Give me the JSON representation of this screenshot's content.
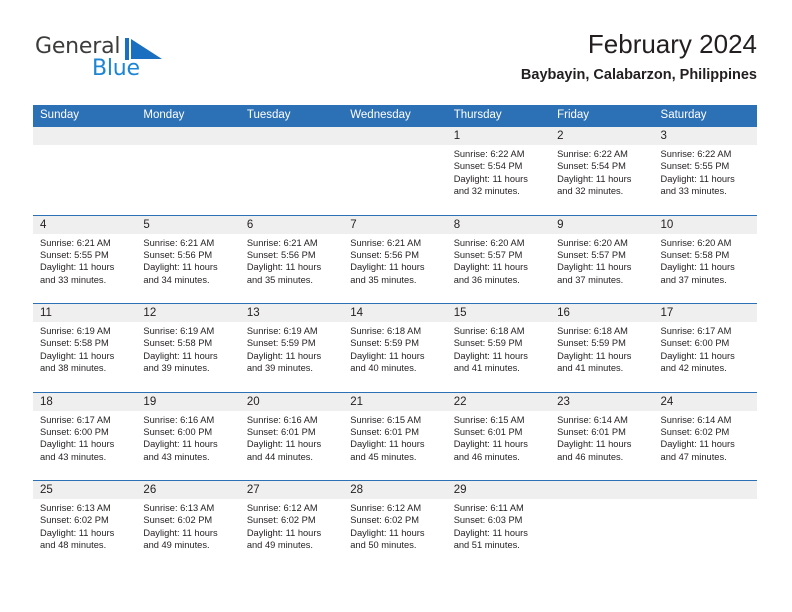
{
  "brand": {
    "name_part1": "General",
    "name_part2": "Blue",
    "sail_icon": "sail-triangle-icon",
    "colors": {
      "general": "#3c3c3b",
      "blue": "#1c86d4"
    }
  },
  "header": {
    "title": "February 2024",
    "subtitle": "Baybayin, Calabarzon, Philippines"
  },
  "theme": {
    "header_blue": "#2c70b5",
    "row_border_blue": "#2c70b5",
    "daynum_band": "#efefef",
    "text": "#231f20"
  },
  "weekdays": [
    "Sunday",
    "Monday",
    "Tuesday",
    "Wednesday",
    "Thursday",
    "Friday",
    "Saturday"
  ],
  "labels": {
    "sunrise": "Sunrise:",
    "sunset": "Sunset:",
    "daylight": "Daylight:"
  },
  "weeks": [
    [
      {
        "day": "",
        "empty": true
      },
      {
        "day": "",
        "empty": true
      },
      {
        "day": "",
        "empty": true
      },
      {
        "day": "",
        "empty": true
      },
      {
        "day": "1",
        "sunrise": "Sunrise: 6:22 AM",
        "sunset": "Sunset: 5:54 PM",
        "daylight_line1": "Daylight: 11 hours",
        "daylight_line2": "and 32 minutes."
      },
      {
        "day": "2",
        "sunrise": "Sunrise: 6:22 AM",
        "sunset": "Sunset: 5:54 PM",
        "daylight_line1": "Daylight: 11 hours",
        "daylight_line2": "and 32 minutes."
      },
      {
        "day": "3",
        "sunrise": "Sunrise: 6:22 AM",
        "sunset": "Sunset: 5:55 PM",
        "daylight_line1": "Daylight: 11 hours",
        "daylight_line2": "and 33 minutes."
      }
    ],
    [
      {
        "day": "4",
        "sunrise": "Sunrise: 6:21 AM",
        "sunset": "Sunset: 5:55 PM",
        "daylight_line1": "Daylight: 11 hours",
        "daylight_line2": "and 33 minutes."
      },
      {
        "day": "5",
        "sunrise": "Sunrise: 6:21 AM",
        "sunset": "Sunset: 5:56 PM",
        "daylight_line1": "Daylight: 11 hours",
        "daylight_line2": "and 34 minutes."
      },
      {
        "day": "6",
        "sunrise": "Sunrise: 6:21 AM",
        "sunset": "Sunset: 5:56 PM",
        "daylight_line1": "Daylight: 11 hours",
        "daylight_line2": "and 35 minutes."
      },
      {
        "day": "7",
        "sunrise": "Sunrise: 6:21 AM",
        "sunset": "Sunset: 5:56 PM",
        "daylight_line1": "Daylight: 11 hours",
        "daylight_line2": "and 35 minutes."
      },
      {
        "day": "8",
        "sunrise": "Sunrise: 6:20 AM",
        "sunset": "Sunset: 5:57 PM",
        "daylight_line1": "Daylight: 11 hours",
        "daylight_line2": "and 36 minutes."
      },
      {
        "day": "9",
        "sunrise": "Sunrise: 6:20 AM",
        "sunset": "Sunset: 5:57 PM",
        "daylight_line1": "Daylight: 11 hours",
        "daylight_line2": "and 37 minutes."
      },
      {
        "day": "10",
        "sunrise": "Sunrise: 6:20 AM",
        "sunset": "Sunset: 5:58 PM",
        "daylight_line1": "Daylight: 11 hours",
        "daylight_line2": "and 37 minutes."
      }
    ],
    [
      {
        "day": "11",
        "sunrise": "Sunrise: 6:19 AM",
        "sunset": "Sunset: 5:58 PM",
        "daylight_line1": "Daylight: 11 hours",
        "daylight_line2": "and 38 minutes."
      },
      {
        "day": "12",
        "sunrise": "Sunrise: 6:19 AM",
        "sunset": "Sunset: 5:58 PM",
        "daylight_line1": "Daylight: 11 hours",
        "daylight_line2": "and 39 minutes."
      },
      {
        "day": "13",
        "sunrise": "Sunrise: 6:19 AM",
        "sunset": "Sunset: 5:59 PM",
        "daylight_line1": "Daylight: 11 hours",
        "daylight_line2": "and 39 minutes."
      },
      {
        "day": "14",
        "sunrise": "Sunrise: 6:18 AM",
        "sunset": "Sunset: 5:59 PM",
        "daylight_line1": "Daylight: 11 hours",
        "daylight_line2": "and 40 minutes."
      },
      {
        "day": "15",
        "sunrise": "Sunrise: 6:18 AM",
        "sunset": "Sunset: 5:59 PM",
        "daylight_line1": "Daylight: 11 hours",
        "daylight_line2": "and 41 minutes."
      },
      {
        "day": "16",
        "sunrise": "Sunrise: 6:18 AM",
        "sunset": "Sunset: 5:59 PM",
        "daylight_line1": "Daylight: 11 hours",
        "daylight_line2": "and 41 minutes."
      },
      {
        "day": "17",
        "sunrise": "Sunrise: 6:17 AM",
        "sunset": "Sunset: 6:00 PM",
        "daylight_line1": "Daylight: 11 hours",
        "daylight_line2": "and 42 minutes."
      }
    ],
    [
      {
        "day": "18",
        "sunrise": "Sunrise: 6:17 AM",
        "sunset": "Sunset: 6:00 PM",
        "daylight_line1": "Daylight: 11 hours",
        "daylight_line2": "and 43 minutes."
      },
      {
        "day": "19",
        "sunrise": "Sunrise: 6:16 AM",
        "sunset": "Sunset: 6:00 PM",
        "daylight_line1": "Daylight: 11 hours",
        "daylight_line2": "and 43 minutes."
      },
      {
        "day": "20",
        "sunrise": "Sunrise: 6:16 AM",
        "sunset": "Sunset: 6:01 PM",
        "daylight_line1": "Daylight: 11 hours",
        "daylight_line2": "and 44 minutes."
      },
      {
        "day": "21",
        "sunrise": "Sunrise: 6:15 AM",
        "sunset": "Sunset: 6:01 PM",
        "daylight_line1": "Daylight: 11 hours",
        "daylight_line2": "and 45 minutes."
      },
      {
        "day": "22",
        "sunrise": "Sunrise: 6:15 AM",
        "sunset": "Sunset: 6:01 PM",
        "daylight_line1": "Daylight: 11 hours",
        "daylight_line2": "and 46 minutes."
      },
      {
        "day": "23",
        "sunrise": "Sunrise: 6:14 AM",
        "sunset": "Sunset: 6:01 PM",
        "daylight_line1": "Daylight: 11 hours",
        "daylight_line2": "and 46 minutes."
      },
      {
        "day": "24",
        "sunrise": "Sunrise: 6:14 AM",
        "sunset": "Sunset: 6:02 PM",
        "daylight_line1": "Daylight: 11 hours",
        "daylight_line2": "and 47 minutes."
      }
    ],
    [
      {
        "day": "25",
        "sunrise": "Sunrise: 6:13 AM",
        "sunset": "Sunset: 6:02 PM",
        "daylight_line1": "Daylight: 11 hours",
        "daylight_line2": "and 48 minutes."
      },
      {
        "day": "26",
        "sunrise": "Sunrise: 6:13 AM",
        "sunset": "Sunset: 6:02 PM",
        "daylight_line1": "Daylight: 11 hours",
        "daylight_line2": "and 49 minutes."
      },
      {
        "day": "27",
        "sunrise": "Sunrise: 6:12 AM",
        "sunset": "Sunset: 6:02 PM",
        "daylight_line1": "Daylight: 11 hours",
        "daylight_line2": "and 49 minutes."
      },
      {
        "day": "28",
        "sunrise": "Sunrise: 6:12 AM",
        "sunset": "Sunset: 6:02 PM",
        "daylight_line1": "Daylight: 11 hours",
        "daylight_line2": "and 50 minutes."
      },
      {
        "day": "29",
        "sunrise": "Sunrise: 6:11 AM",
        "sunset": "Sunset: 6:03 PM",
        "daylight_line1": "Daylight: 11 hours",
        "daylight_line2": "and 51 minutes."
      },
      {
        "day": "",
        "empty": true
      },
      {
        "day": "",
        "empty": true
      }
    ]
  ]
}
